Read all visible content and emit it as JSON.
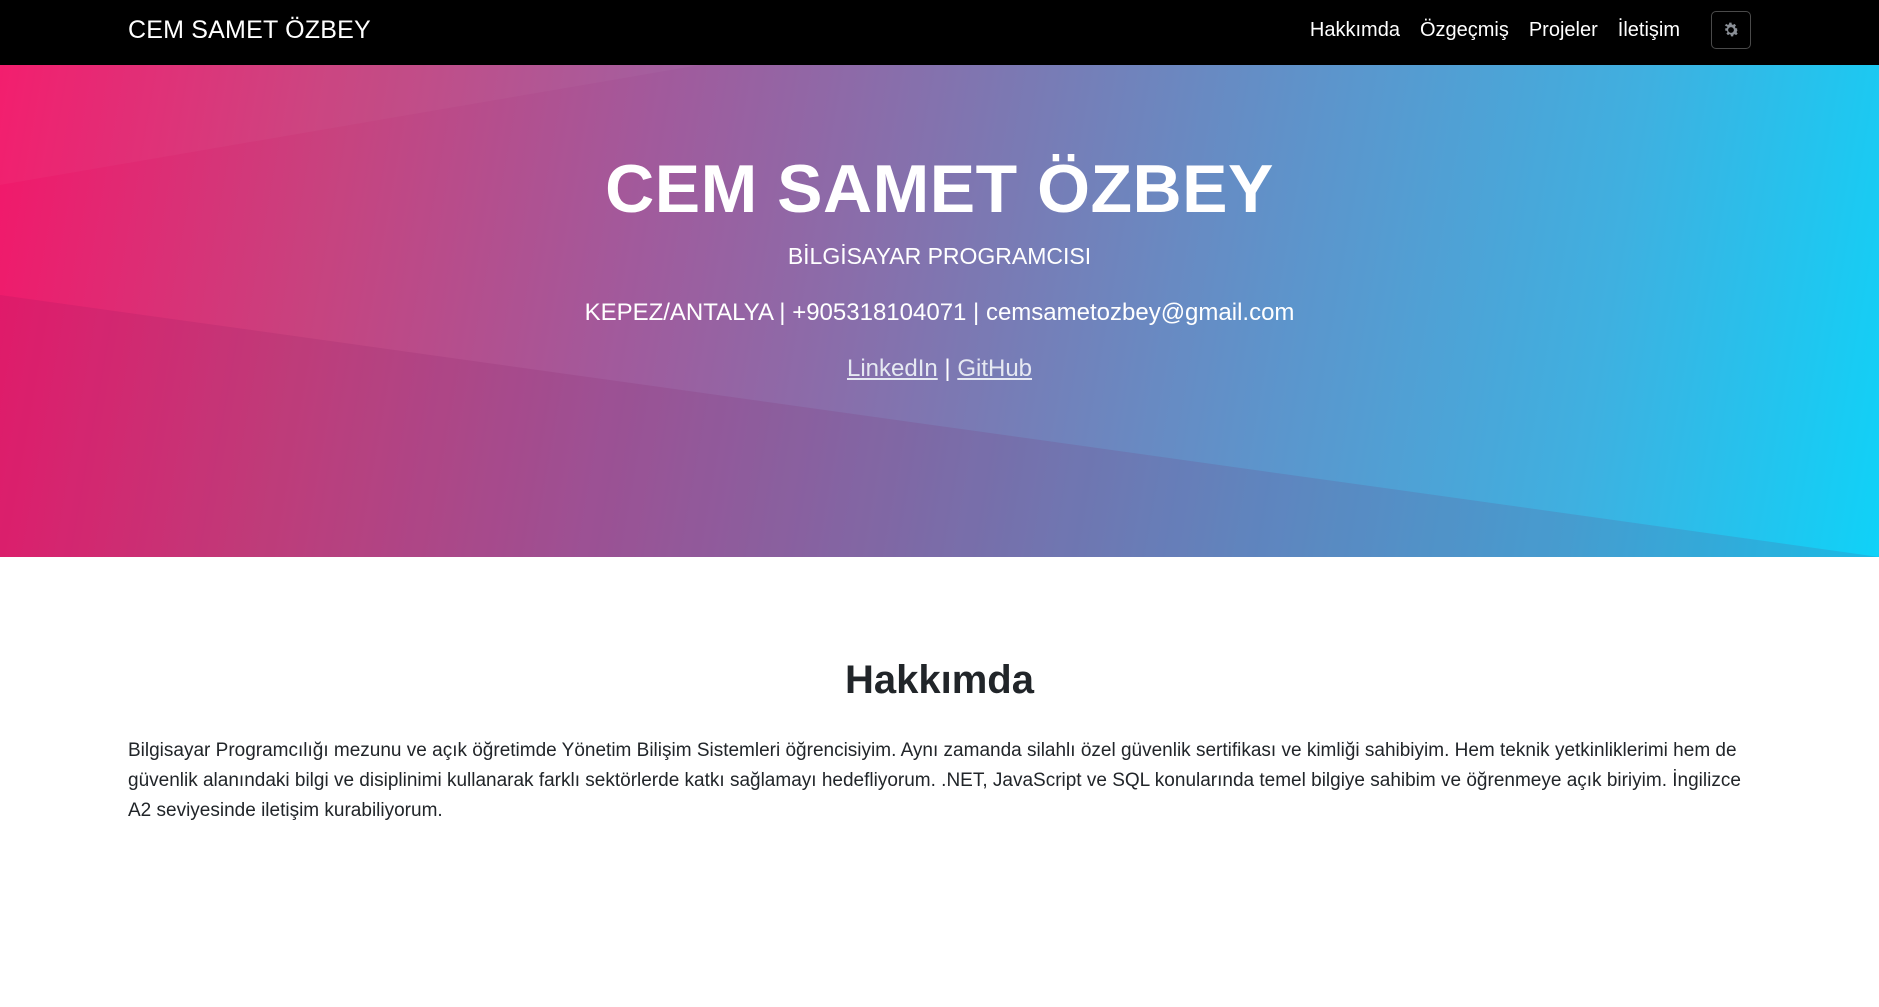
{
  "nav": {
    "brand": "CEM SAMET ÖZBEY",
    "links": [
      "Hakkımda",
      "Özgeçmiş",
      "Projeler",
      "İletişim"
    ],
    "theme_toggle_icon": "gear-icon"
  },
  "hero": {
    "title": "CEM SAMET ÖZBEY",
    "subtitle": "BİLGİSAYAR PROGRAMCISI",
    "contact": "KEPEZ/ANTALYA | +905318104071 | cemsametozbey@gmail.com",
    "linkedin": "LinkedIn",
    "separator": "|",
    "github": "GitHub",
    "gradient_colors": [
      "#f3176a",
      "#a15a9c",
      "#5c95cc",
      "#0fd2f8"
    ]
  },
  "about": {
    "title": "Hakkımda",
    "text": "Bilgisayar Programcılığı mezunu ve açık öğretimde Yönetim Bilişim Sistemleri öğrencisiyim. Aynı zamanda silahlı özel güvenlik sertifikası ve kimliği sahibiyim. Hem teknik yetkinliklerimi hem de güvenlik alanındaki bilgi ve disiplinimi kullanarak farklı sektörlerde katkı sağlamayı hedefliyorum. .NET, JavaScript ve SQL konularında temel bilgiye sahibim ve öğrenmeye açık biriyim. İngilizce A2 seviyesinde iletişim kurabiliyorum."
  }
}
